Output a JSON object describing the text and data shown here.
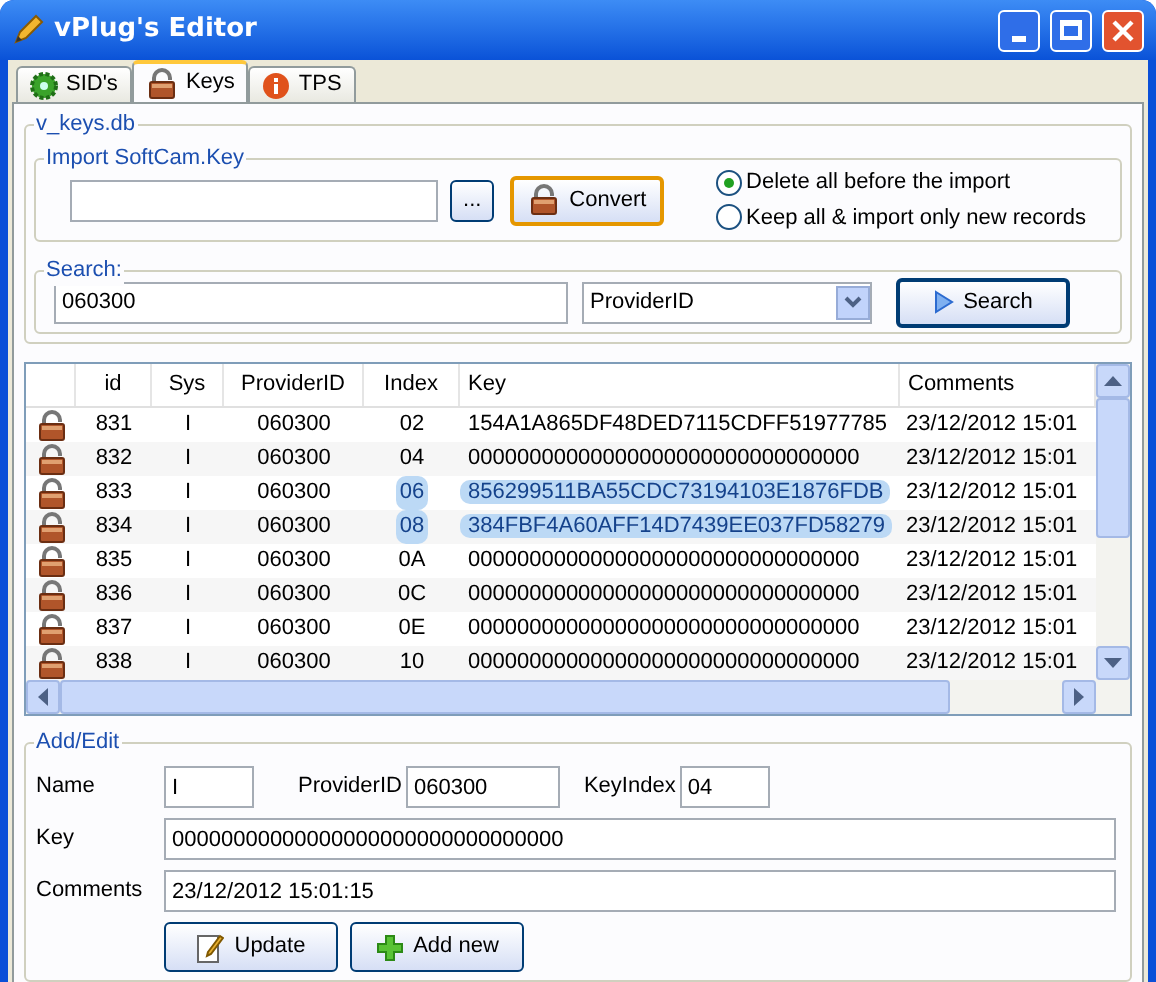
{
  "window": {
    "title": "vPlug's Editor"
  },
  "tabs": [
    {
      "label": "SID's",
      "selected": false
    },
    {
      "label": "Keys",
      "selected": true
    },
    {
      "label": "TPS",
      "selected": false
    }
  ],
  "db_group": {
    "title": "v_keys.db"
  },
  "import": {
    "title": "Import SoftCam.Key",
    "browse_label": "...",
    "convert_label": "Convert",
    "options": [
      {
        "label": "Delete all before the import",
        "selected": true
      },
      {
        "label": "Keep all & import only new records",
        "selected": false
      }
    ]
  },
  "search": {
    "title": "Search:",
    "value": "060300",
    "field": "ProviderID",
    "button": "Search"
  },
  "table": {
    "columns": [
      "id",
      "Sys",
      "ProviderID",
      "Index",
      "Key",
      "Comments"
    ],
    "rows": [
      {
        "id": "831",
        "sys": "I",
        "provider": "060300",
        "index": "02",
        "key": "154A1A865DF48DED7115CDFF51977785",
        "comments": "23/12/2012 15:01",
        "selected": false
      },
      {
        "id": "832",
        "sys": "I",
        "provider": "060300",
        "index": "04",
        "key": "00000000000000000000000000000000",
        "comments": "23/12/2012 15:01",
        "selected": false
      },
      {
        "id": "833",
        "sys": "I",
        "provider": "060300",
        "index": "06",
        "key": "856299511BA55CDC73194103E1876FDB",
        "comments": "23/12/2012 15:01",
        "selected": true
      },
      {
        "id": "834",
        "sys": "I",
        "provider": "060300",
        "index": "08",
        "key": "384FBF4A60AFF14D7439EE037FD58279",
        "comments": "23/12/2012 15:01",
        "selected": true
      },
      {
        "id": "835",
        "sys": "I",
        "provider": "060300",
        "index": "0A",
        "key": "00000000000000000000000000000000",
        "comments": "23/12/2012 15:01",
        "selected": false
      },
      {
        "id": "836",
        "sys": "I",
        "provider": "060300",
        "index": "0C",
        "key": "00000000000000000000000000000000",
        "comments": "23/12/2012 15:01",
        "selected": false
      },
      {
        "id": "837",
        "sys": "I",
        "provider": "060300",
        "index": "0E",
        "key": "00000000000000000000000000000000",
        "comments": "23/12/2012 15:01",
        "selected": false
      },
      {
        "id": "838",
        "sys": "I",
        "provider": "060300",
        "index": "10",
        "key": "00000000000000000000000000000000",
        "comments": "23/12/2012 15:01",
        "selected": false
      }
    ]
  },
  "edit": {
    "title": "Add/Edit",
    "name_label": "Name",
    "name": "I",
    "provider_label": "ProviderID",
    "provider": "060300",
    "keyindex_label": "KeyIndex",
    "keyindex": "04",
    "key_label": "Key",
    "key": "00000000000000000000000000000000",
    "comments_label": "Comments",
    "comments": "23/12/2012 15:01:15",
    "update": "Update",
    "add": "Add new"
  }
}
